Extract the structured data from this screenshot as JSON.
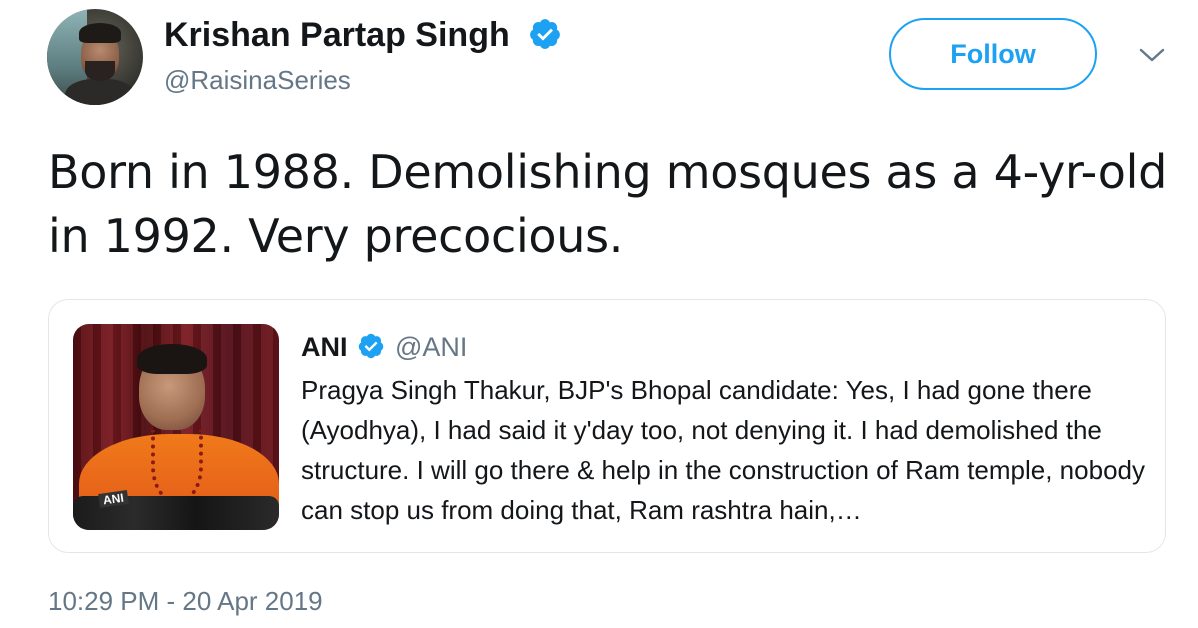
{
  "author": {
    "name": "Krishan Partap Singh",
    "handle": "@RaisinaSeries",
    "verified": true,
    "avatar_icon": "profile-photo-man"
  },
  "follow_button": {
    "label": "Follow"
  },
  "menu": {
    "icon": "chevron-down-icon"
  },
  "tweet": {
    "text": "Born in 1988. Demolishing mosques as a 4-yr-old in 1992. Very precocious.",
    "timestamp": "10:29 PM - 20 Apr 2019"
  },
  "quoted_tweet": {
    "name": "ANI",
    "handle": "@ANI",
    "verified": true,
    "media_icon": "press-conference-photo",
    "media_watermark": "ANI",
    "text": "Pragya Singh Thakur, BJP's Bhopal candidate: Yes, I had gone there (Ayodhya), I had said it y'day too, not denying it. I had demolished the structure. I will go there & help in the construction of Ram temple, nobody can stop us from doing that, Ram rashtra hain,…"
  },
  "colors": {
    "accent": "#1da1f2",
    "text_primary": "#14171a",
    "text_secondary": "#657786",
    "border": "#e1e8ed"
  }
}
